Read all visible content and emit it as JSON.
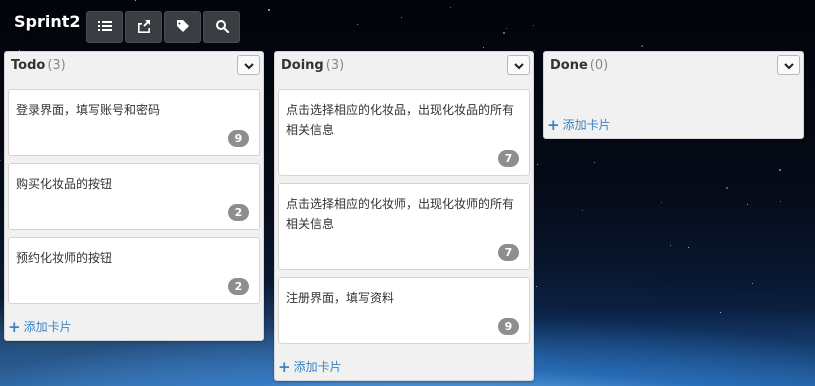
{
  "board": {
    "title": "Sprint2",
    "toolbar": [
      {
        "icon": "list-icon",
        "name": "list-view-button"
      },
      {
        "icon": "share-icon",
        "name": "share-button"
      },
      {
        "icon": "tag-icon",
        "name": "tags-button"
      },
      {
        "icon": "search-icon",
        "name": "search-button"
      }
    ]
  },
  "lists": [
    {
      "name": "Todo",
      "count": "(3)",
      "add_label": "添加卡片",
      "cards": [
        {
          "title": "登录界面，填写账号和密码",
          "badge": "9"
        },
        {
          "title": "购买化妆品的按钮",
          "badge": "2"
        },
        {
          "title": "预约化妆师的按钮",
          "badge": "2"
        }
      ]
    },
    {
      "name": "Doing",
      "count": "(3)",
      "add_label": "添加卡片",
      "cards": [
        {
          "title": "点击选择相应的化妆品，出现化妆品的所有相关信息",
          "badge": "7"
        },
        {
          "title": "点击选择相应的化妆师，出现化妆师的所有相关信息",
          "badge": "7"
        },
        {
          "title": "注册界面，填写资料",
          "badge": "9"
        }
      ]
    },
    {
      "name": "Done",
      "count": "(0)",
      "add_label": "添加卡片",
      "cards": []
    }
  ],
  "colors": {
    "link": "#3b84c2",
    "badge": "#8e8e8e",
    "list_bg": "#f1f1f1",
    "toolbar_button": "#3a3d42"
  }
}
